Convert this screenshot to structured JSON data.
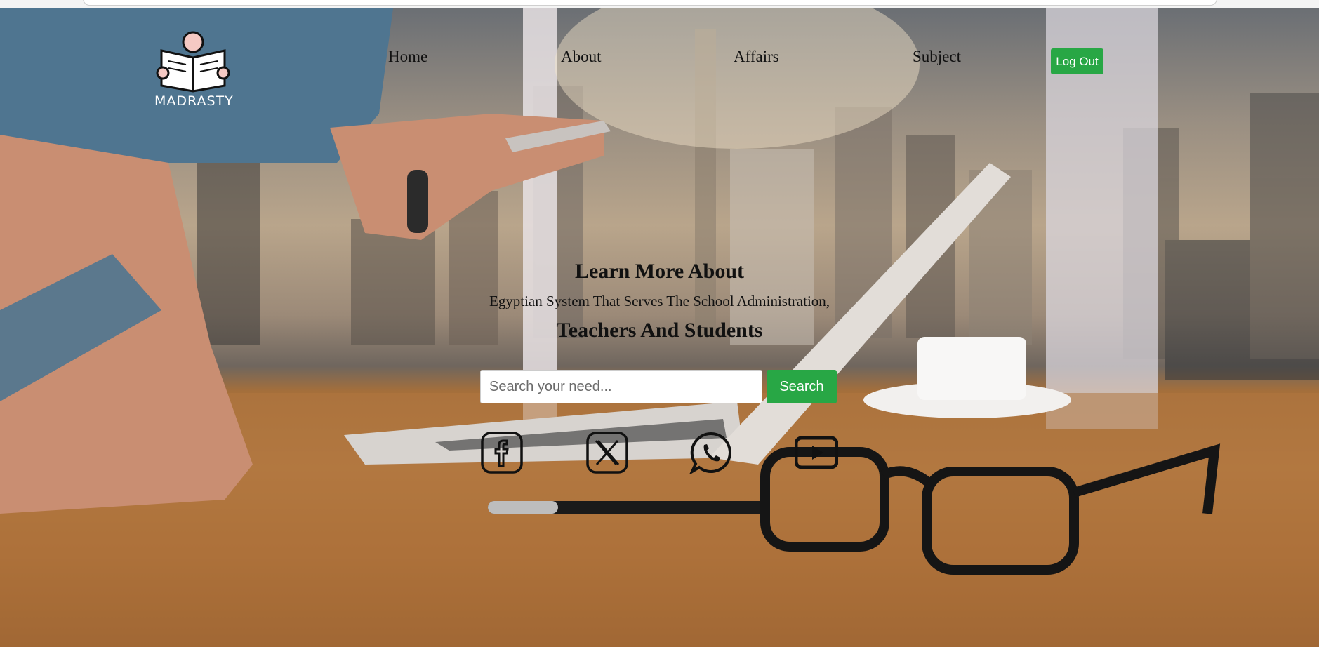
{
  "brand": {
    "name": "MADRASTY"
  },
  "nav": {
    "home": "Home",
    "about": "About",
    "affairs": "Affairs",
    "subject": "Subject",
    "logout": "Log Out"
  },
  "hero": {
    "title": "Learn More About",
    "subtitle": "Egyptian System That Serves The School Administration,",
    "title2": "Teachers And Students"
  },
  "search": {
    "placeholder": "Search your need...",
    "button_label": "Search"
  },
  "social": {
    "icons": [
      "facebook-icon",
      "x-twitter-icon",
      "whatsapp-icon",
      "youtube-icon"
    ]
  },
  "colors": {
    "accent_green": "#28a745",
    "text_dark": "#111111",
    "logo_white": "#ffffff"
  }
}
